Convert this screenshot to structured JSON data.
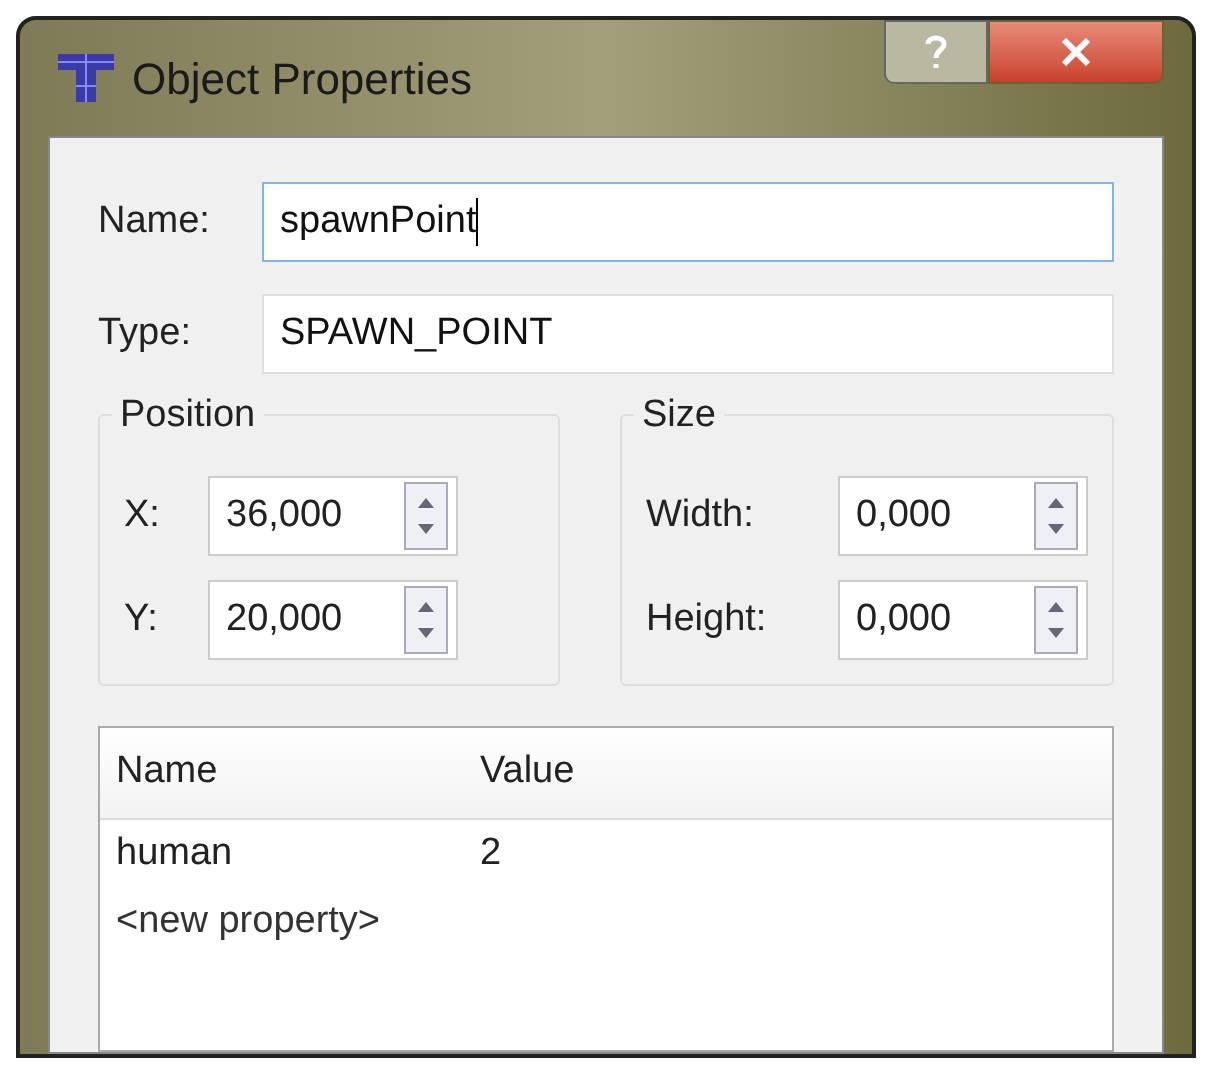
{
  "window": {
    "title": "Object Properties"
  },
  "fields": [
    {
      "label": "Name:",
      "value": "spawnPoint",
      "focused": true
    },
    {
      "label": "Type:",
      "value": "SPAWN_POINT",
      "focused": false
    }
  ],
  "groups": [
    {
      "title": "Position",
      "spinners": [
        {
          "label": "X:",
          "value": "36,000"
        },
        {
          "label": "Y:",
          "value": "20,000"
        }
      ]
    },
    {
      "title": "Size",
      "spinners": [
        {
          "label": "Width:",
          "value": "0,000"
        },
        {
          "label": "Height:",
          "value": "0,000"
        }
      ]
    }
  ],
  "properties": {
    "columns": [
      "Name",
      "Value"
    ],
    "rows": [
      {
        "kind": "property",
        "name": "human",
        "value": "2"
      },
      {
        "kind": "new",
        "name": "<new property>"
      }
    ]
  }
}
